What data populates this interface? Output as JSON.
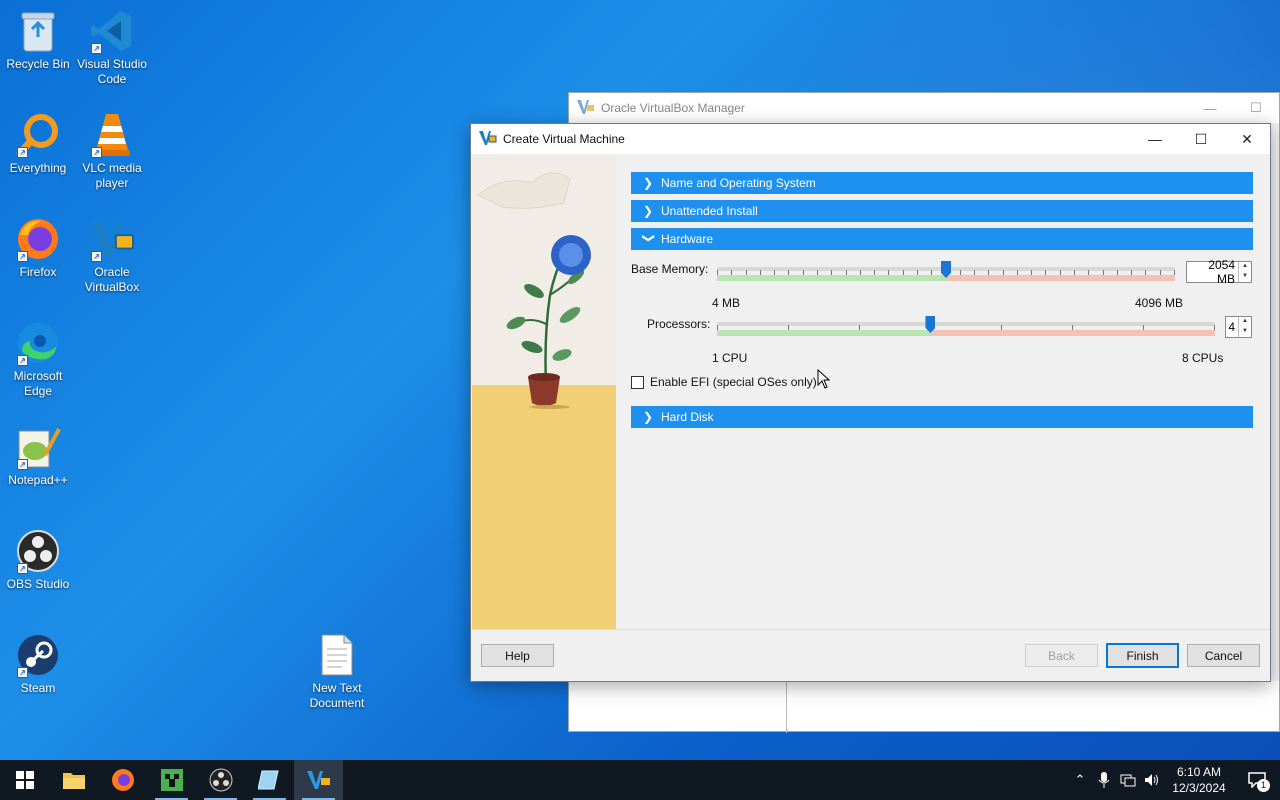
{
  "desktop": {
    "icons": [
      {
        "label": "Recycle Bin",
        "icon": "recycle-bin-icon"
      },
      {
        "label": "Visual Studio Code",
        "icon": "vscode-icon"
      },
      {
        "label": "Everything",
        "icon": "everything-search-icon"
      },
      {
        "label": "VLC media player",
        "icon": "vlc-icon"
      },
      {
        "label": "Firefox",
        "icon": "firefox-icon"
      },
      {
        "label": "Oracle VirtualBox",
        "icon": "virtualbox-icon"
      },
      {
        "label": "Microsoft Edge",
        "icon": "edge-icon"
      },
      {
        "label": "Notepad++",
        "icon": "notepadpp-icon"
      },
      {
        "label": "OBS Studio",
        "icon": "obs-icon"
      },
      {
        "label": "Steam",
        "icon": "steam-icon"
      },
      {
        "label": "New Text Document",
        "icon": "text-document-icon"
      }
    ]
  },
  "manager_window": {
    "title": "Oracle VirtualBox Manager",
    "minimize": "—",
    "maximize": "☐"
  },
  "dialog": {
    "title": "Create Virtual Machine",
    "minimize": "—",
    "maximize": "☐",
    "close": "✕",
    "sections": {
      "name_os": "Name and Operating System",
      "unattended": "Unattended Install",
      "hardware": "Hardware",
      "hard_disk": "Hard Disk"
    },
    "hardware": {
      "memory_label": "Base Memory:",
      "memory_value": "2054 MB",
      "memory_min": "4 MB",
      "memory_max": "4096 MB",
      "memory_fraction": 0.5,
      "processors_label": "Processors:",
      "processors_value": "4",
      "processors_min": "1 CPU",
      "processors_max": "8 CPUs",
      "processors_fraction": 0.4286,
      "efi_label": "Enable EFI (special OSes only)",
      "efi_checked": false
    },
    "buttons": {
      "help": "Help",
      "back": "Back",
      "finish": "Finish",
      "cancel": "Cancel"
    }
  },
  "taskbar": {
    "items": [
      "start-icon",
      "file-explorer-icon",
      "firefox-icon",
      "minecraft-icon",
      "obs-icon",
      "notepad-icon",
      "virtualbox-icon"
    ],
    "clock_time": "6:10 AM",
    "clock_date": "12/3/2024",
    "notification_count": "1"
  },
  "colors": {
    "accent": "#1e90f0",
    "desktop": "#0a6fd6",
    "taskbar": "#101822"
  }
}
